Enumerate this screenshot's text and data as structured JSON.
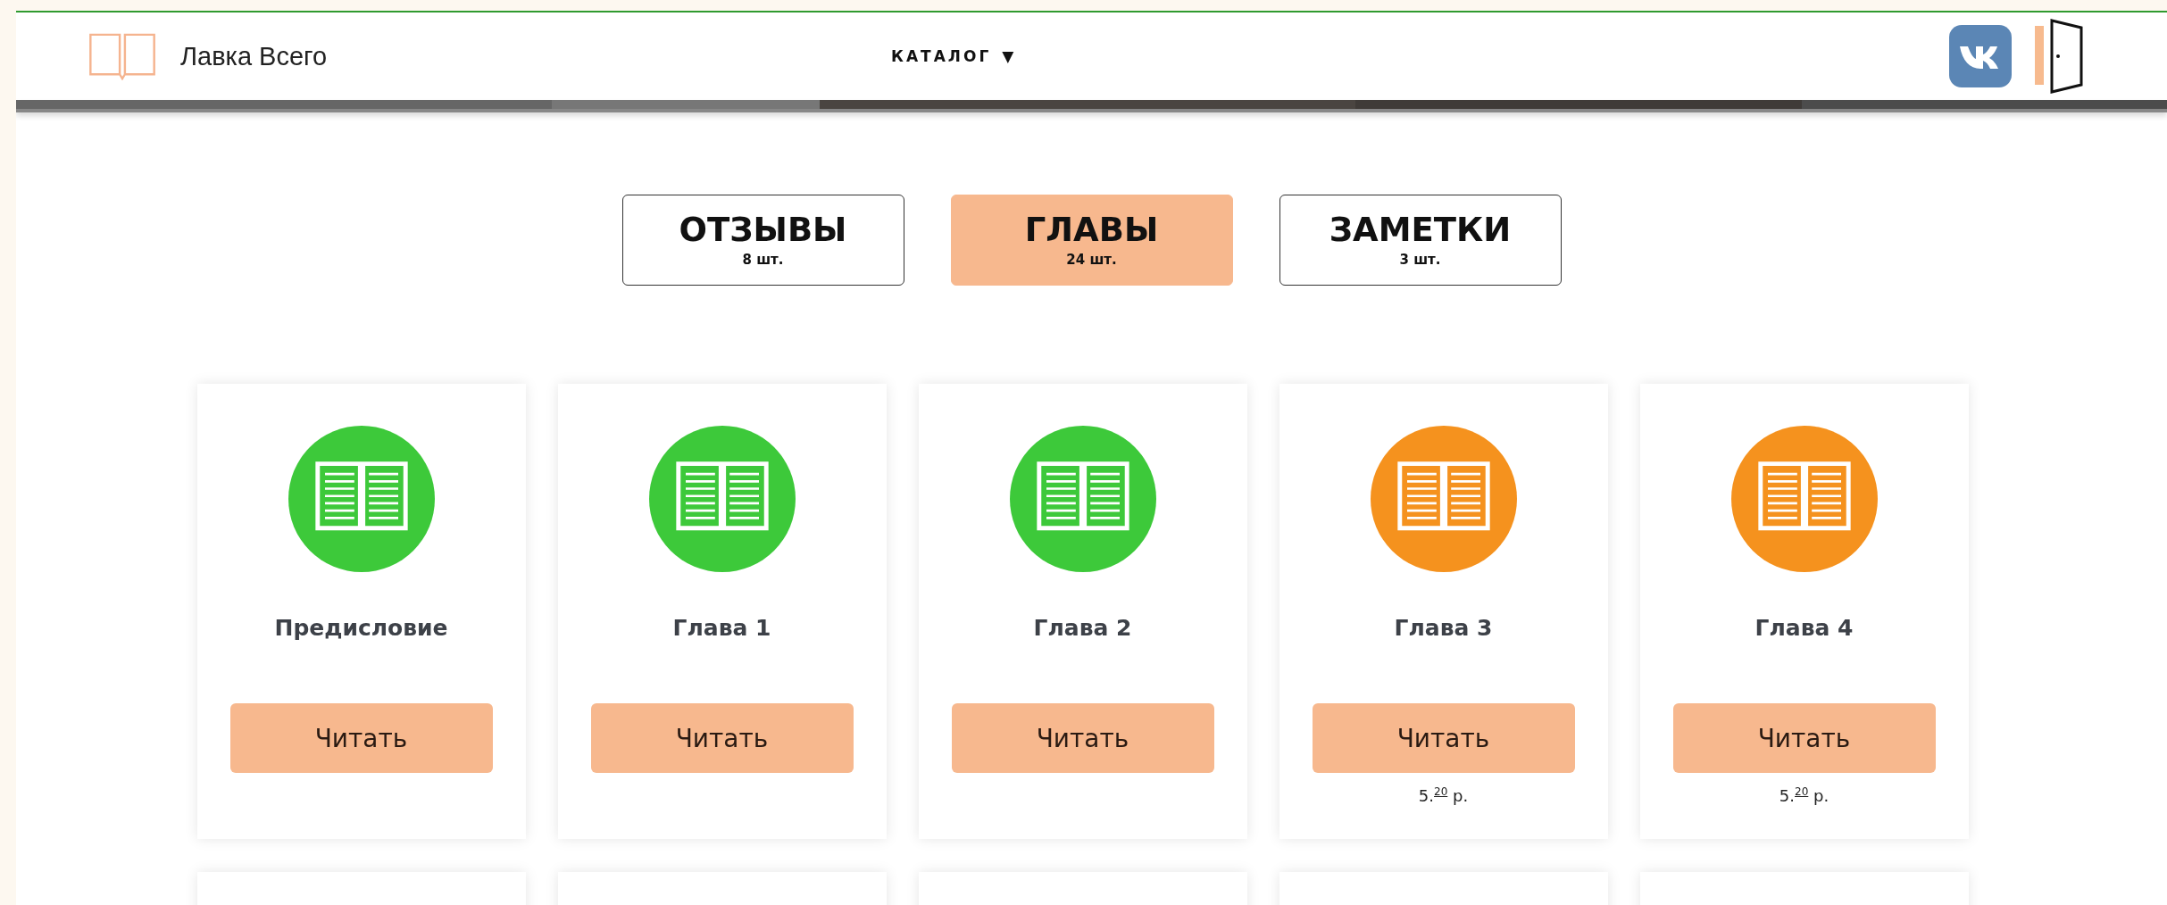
{
  "header": {
    "site_name": "Лавка Всего",
    "menu": {
      "label": "КАТАЛОГ",
      "caret": "▼"
    }
  },
  "tabs": [
    {
      "label": "ОТЗЫВЫ",
      "count": "8 шт.",
      "selected": false
    },
    {
      "label": "ГЛАВЫ",
      "count": "24 шт.",
      "selected": true
    },
    {
      "label": "ЗАМЕТКИ",
      "count": "3 шт.",
      "selected": false
    }
  ],
  "chapters": [
    {
      "kind": "chapter",
      "title": "Предисловие",
      "color": "#3dc93a",
      "button": "Читать"
    },
    {
      "kind": "chapter",
      "title": "Глава 1",
      "color": "#3dc93a",
      "button": "Читать"
    },
    {
      "kind": "chapter",
      "title": "Глава 2",
      "color": "#3dc93a",
      "button": "Читать"
    },
    {
      "kind": "chapter",
      "title": "Глава 3",
      "color": "#f5921e",
      "button": "Читать",
      "price": "5.$^{20}$ р."
    },
    {
      "kind": "chapter",
      "title": "Глава 4",
      "color": "#f5921e",
      "button": "Читать",
      "price": "5.$^{20}$ р."
    },
    {
      "kind": "partial"
    },
    {
      "kind": "partial"
    },
    {
      "kind": "partial"
    },
    {
      "kind": "partial"
    },
    {
      "kind": "partial"
    }
  ]
}
